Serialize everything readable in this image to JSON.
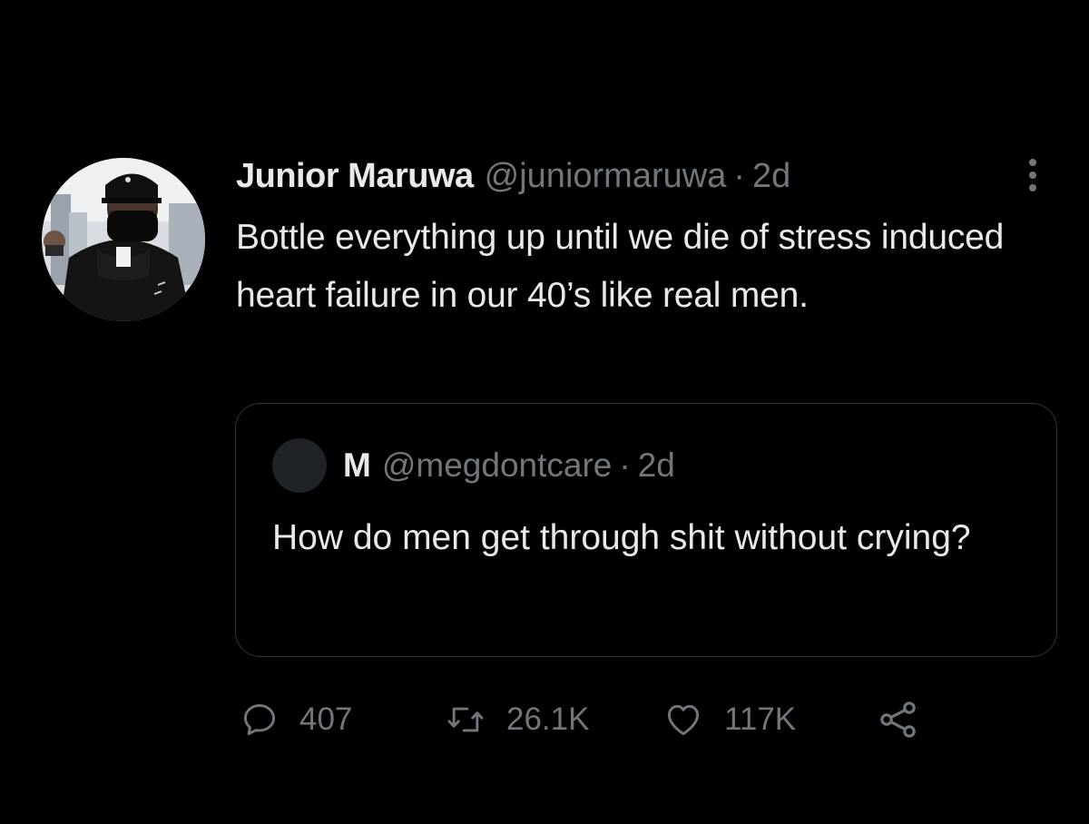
{
  "tweet": {
    "author_name": "Junior Maruwa",
    "author_handle": "@juniormaruwa",
    "separator": "·",
    "timestamp": "2d",
    "text": "Bottle everything up until we die of stress induced heart failure in our 40’s like real men.",
    "avatar_icon": "person-in-cap-and-mask-avatar",
    "more_icon": "more-vertical-icon"
  },
  "quote": {
    "author_name": "M",
    "author_handle": "@megdontcare",
    "separator": "·",
    "timestamp": "2d",
    "text": "How do men get through shit without crying?"
  },
  "actions": {
    "reply": {
      "icon": "reply-icon",
      "count": "407"
    },
    "retweet": {
      "icon": "retweet-icon",
      "count": "26.1K"
    },
    "like": {
      "icon": "heart-icon",
      "count": "117K"
    },
    "share": {
      "icon": "share-icon"
    }
  },
  "colors": {
    "background": "#000000",
    "primary_text": "#e7e9ea",
    "secondary_text": "#71767b",
    "border": "#2f3336"
  }
}
